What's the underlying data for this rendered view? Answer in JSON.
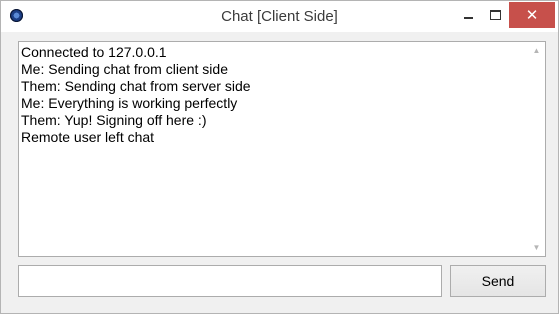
{
  "window": {
    "title": "Chat [Client Side]",
    "controls": {
      "minimize_icon": "minimize-icon",
      "maximize_icon": "maximize-icon",
      "close_glyph": "✕"
    },
    "app_icon": "app-orb-icon",
    "colors": {
      "close_button": "#c7504b",
      "window_bg": "#f0f0f0"
    }
  },
  "chat": {
    "messages": [
      "Connected to 127.0.0.1",
      "Me: Sending chat from client side",
      "Them: Sending chat from server side",
      "Me: Everything is working perfectly",
      "Them: Yup! Signing off here :)",
      "Remote user left chat"
    ],
    "scroll_up_glyph": "▲",
    "scroll_down_glyph": "▼"
  },
  "composer": {
    "input_value": "",
    "send_label": "Send"
  }
}
